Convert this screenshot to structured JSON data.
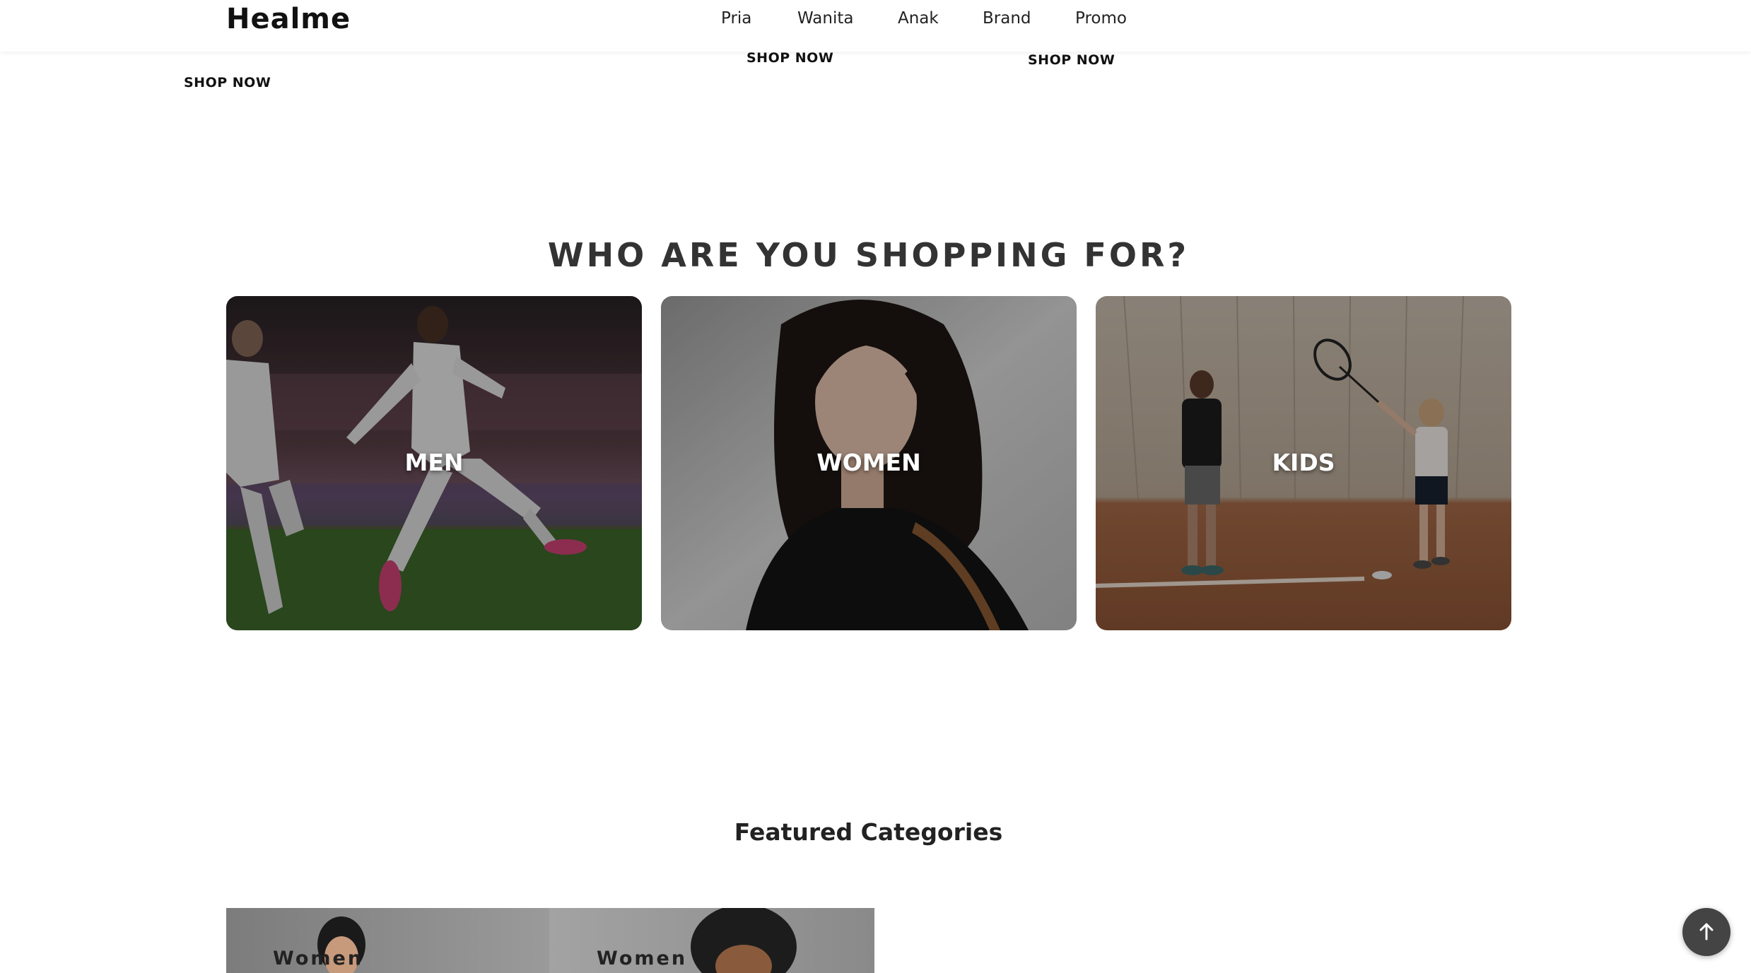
{
  "header": {
    "logo": "Healme",
    "nav": [
      {
        "label": "Pria"
      },
      {
        "label": "Wanita"
      },
      {
        "label": "Anak"
      },
      {
        "label": "Brand"
      },
      {
        "label": "Promo"
      }
    ]
  },
  "hero": {
    "shop_now_labels": [
      "SHOP NOW",
      "SHOP NOW",
      "SHOP NOW"
    ]
  },
  "shopping_for": {
    "title": "WHO ARE YOU SHOPPING FOR?",
    "cards": [
      {
        "label": "MEN"
      },
      {
        "label": "WOMEN"
      },
      {
        "label": "KIDS"
      }
    ]
  },
  "featured": {
    "title": "Featured Categories",
    "tiles": [
      {
        "label": "Women"
      },
      {
        "label": "Women"
      }
    ]
  },
  "back_to_top": {
    "icon": "arrow-up-icon"
  }
}
